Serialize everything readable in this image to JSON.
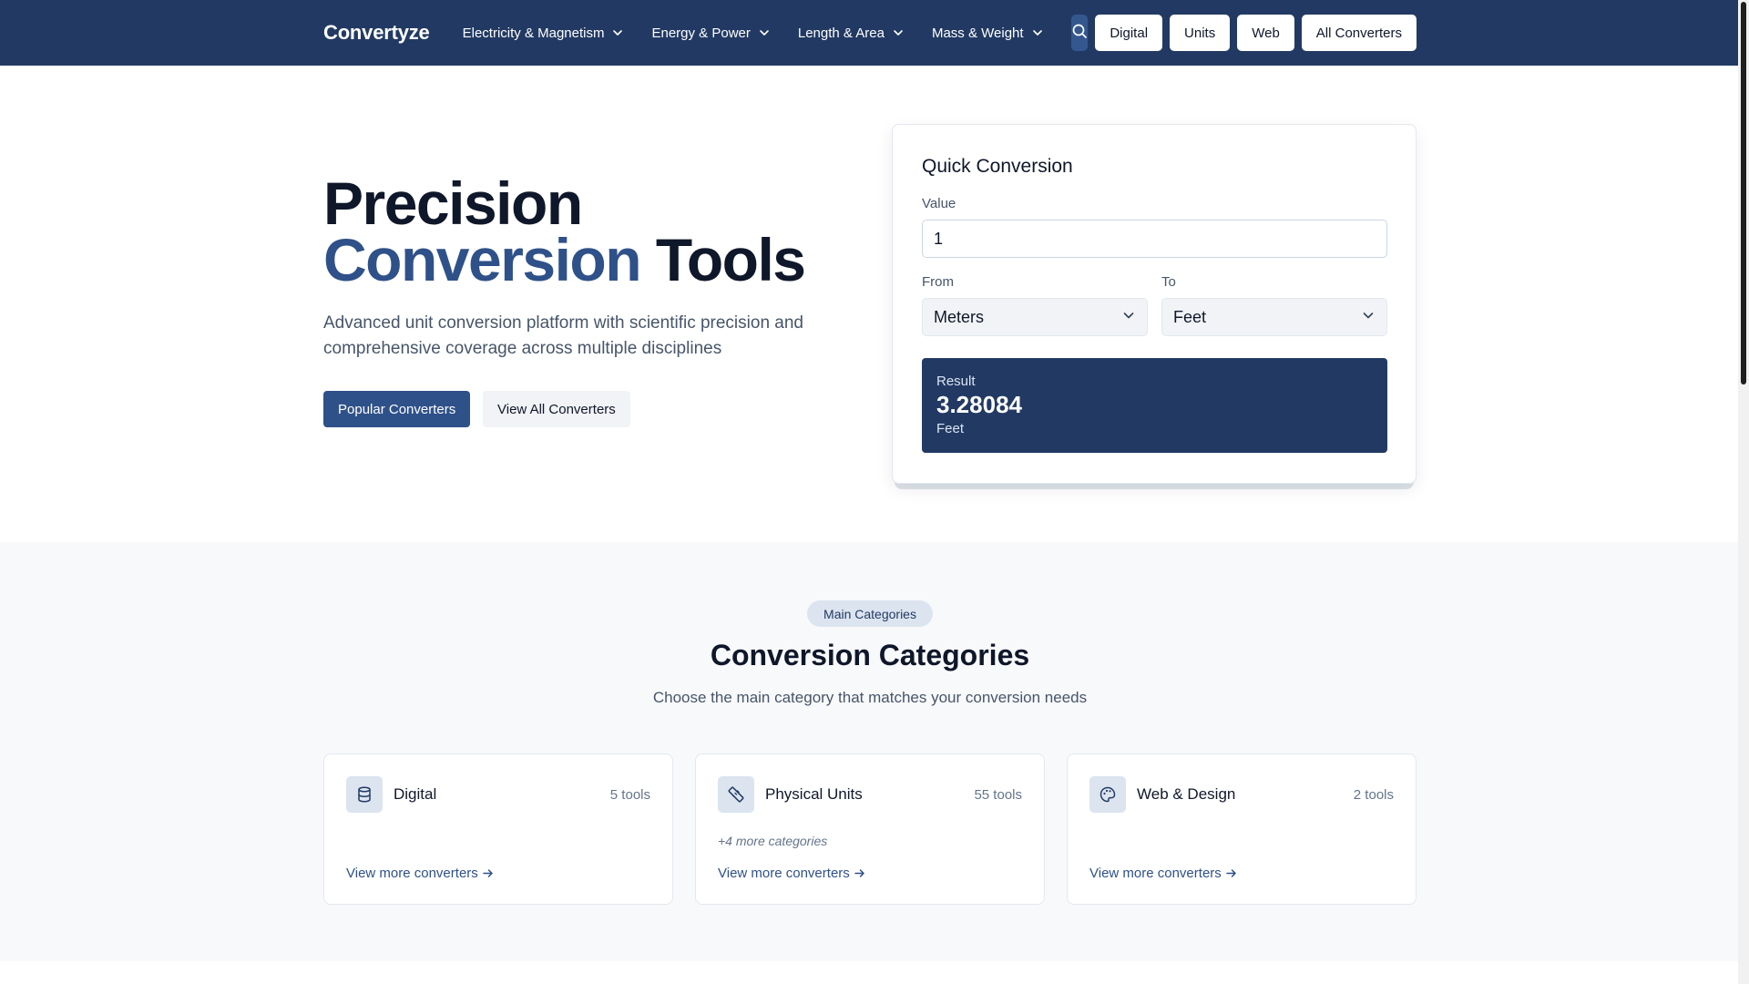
{
  "header": {
    "brand": "Convertyze",
    "menu": [
      {
        "label": "Electricity & Magnetism",
        "icon": "chevron-down-icon"
      },
      {
        "label": "Energy & Power",
        "icon": "chevron-down-icon"
      },
      {
        "label": "Length & Area",
        "icon": "chevron-down-icon"
      },
      {
        "label": "Mass & Weight",
        "icon": "chevron-down-icon"
      }
    ],
    "search_icon": "search-icon",
    "quick_links": [
      "Digital",
      "Units",
      "Web",
      "All Converters"
    ]
  },
  "hero": {
    "title_line1": "Precision",
    "title_accent": "Conversion",
    "title_rest": "Tools",
    "subtitle": "Advanced unit conversion platform with scientific precision and comprehensive coverage across multiple disciplines",
    "primary_button": "Popular Converters",
    "secondary_button": "View All Converters"
  },
  "quick_conversion": {
    "title": "Quick Conversion",
    "value_label": "Value",
    "value": "1",
    "from_label": "From",
    "from_value": "Meters",
    "to_label": "To",
    "to_value": "Feet",
    "result_label": "Result",
    "result_value": "3.28084",
    "result_unit": "Feet"
  },
  "categories": {
    "badge": "Main Categories",
    "heading": "Conversion Categories",
    "subheading": "Choose the main category that matches your conversion needs",
    "cards": [
      {
        "name": "Digital",
        "count": "5 tools",
        "icon": "database-icon",
        "more": "",
        "link": "View more converters"
      },
      {
        "name": "Physical Units",
        "count": "55 tools",
        "icon": "ruler-icon",
        "more": "+4 more categories",
        "link": "View more converters"
      },
      {
        "name": "Web & Design",
        "count": "2 tools",
        "icon": "palette-icon",
        "more": "",
        "link": "View more converters"
      }
    ]
  },
  "colors": {
    "navy": "#223a63",
    "accent": "#2f5189",
    "badge_bg": "#dce4f0"
  }
}
